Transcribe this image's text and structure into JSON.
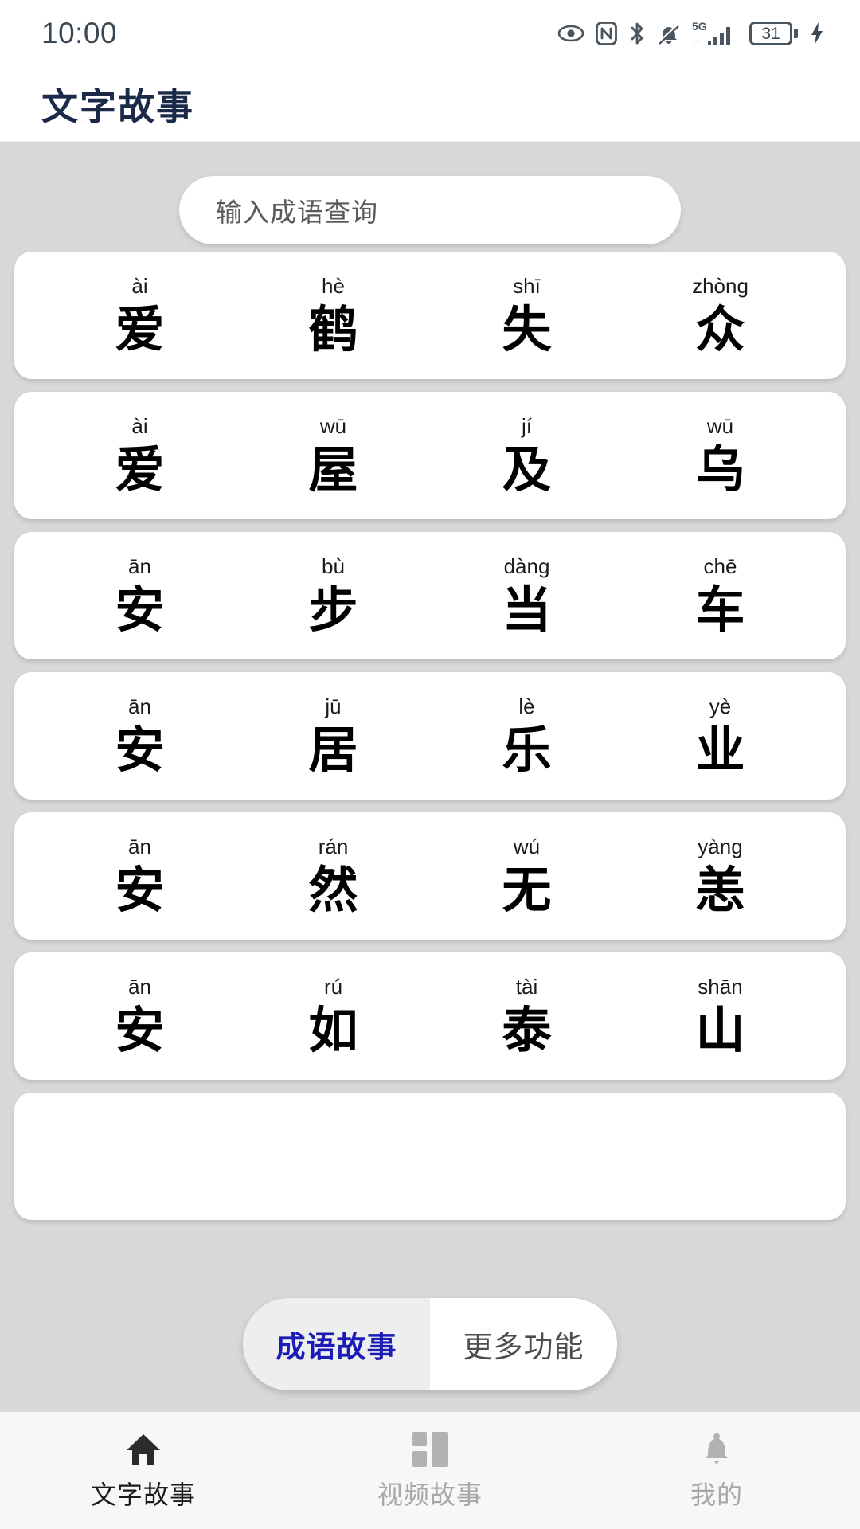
{
  "status_bar": {
    "time": "10:00",
    "battery_level": "31",
    "network_label": "5G",
    "icons": [
      "eye-icon",
      "nfc-icon",
      "bluetooth-icon",
      "bell-muted-icon",
      "signal-5g-icon",
      "battery-icon",
      "charging-bolt-icon"
    ]
  },
  "header": {
    "title": "文字故事"
  },
  "search": {
    "placeholder": "输入成语查询",
    "value": ""
  },
  "idiom_list": [
    {
      "idiom": "爱鹤失众",
      "chars": [
        {
          "pinyin": "ài",
          "hanzi": "爱"
        },
        {
          "pinyin": "hè",
          "hanzi": "鹤"
        },
        {
          "pinyin": "shī",
          "hanzi": "失"
        },
        {
          "pinyin": "zhòng",
          "hanzi": "众"
        }
      ]
    },
    {
      "idiom": "爱屋及乌",
      "chars": [
        {
          "pinyin": "ài",
          "hanzi": "爱"
        },
        {
          "pinyin": "wū",
          "hanzi": "屋"
        },
        {
          "pinyin": "jí",
          "hanzi": "及"
        },
        {
          "pinyin": "wū",
          "hanzi": "乌"
        }
      ]
    },
    {
      "idiom": "安步当车",
      "chars": [
        {
          "pinyin": "ān",
          "hanzi": "安"
        },
        {
          "pinyin": "bù",
          "hanzi": "步"
        },
        {
          "pinyin": "dàng",
          "hanzi": "当"
        },
        {
          "pinyin": "chē",
          "hanzi": "车"
        }
      ]
    },
    {
      "idiom": "安居乐业",
      "chars": [
        {
          "pinyin": "ān",
          "hanzi": "安"
        },
        {
          "pinyin": "jū",
          "hanzi": "居"
        },
        {
          "pinyin": "lè",
          "hanzi": "乐"
        },
        {
          "pinyin": "yè",
          "hanzi": "业"
        }
      ]
    },
    {
      "idiom": "安然无恙",
      "chars": [
        {
          "pinyin": "ān",
          "hanzi": "安"
        },
        {
          "pinyin": "rán",
          "hanzi": "然"
        },
        {
          "pinyin": "wú",
          "hanzi": "无"
        },
        {
          "pinyin": "yàng",
          "hanzi": "恙"
        }
      ]
    },
    {
      "idiom": "安如泰山",
      "chars": [
        {
          "pinyin": "ān",
          "hanzi": "安"
        },
        {
          "pinyin": "rú",
          "hanzi": "如"
        },
        {
          "pinyin": "tài",
          "hanzi": "泰"
        },
        {
          "pinyin": "shān",
          "hanzi": "山"
        }
      ]
    }
  ],
  "segmented_tabs": {
    "selected": "成语故事",
    "items": [
      {
        "label": "成语故事",
        "active": true
      },
      {
        "label": "更多功能",
        "active": false
      }
    ]
  },
  "bottom_nav": {
    "items": [
      {
        "label": "文字故事",
        "icon": "home-icon",
        "active": true
      },
      {
        "label": "视频故事",
        "icon": "grid-icon",
        "active": false
      },
      {
        "label": "我的",
        "icon": "bell-icon",
        "active": false
      }
    ]
  },
  "colors": {
    "page_background": "#d8d8d8",
    "card_background": "#ffffff",
    "title": "#1c2a4a",
    "accent_selected_tab": "#1b1bb5",
    "inactive_text": "#a8a8a8"
  }
}
